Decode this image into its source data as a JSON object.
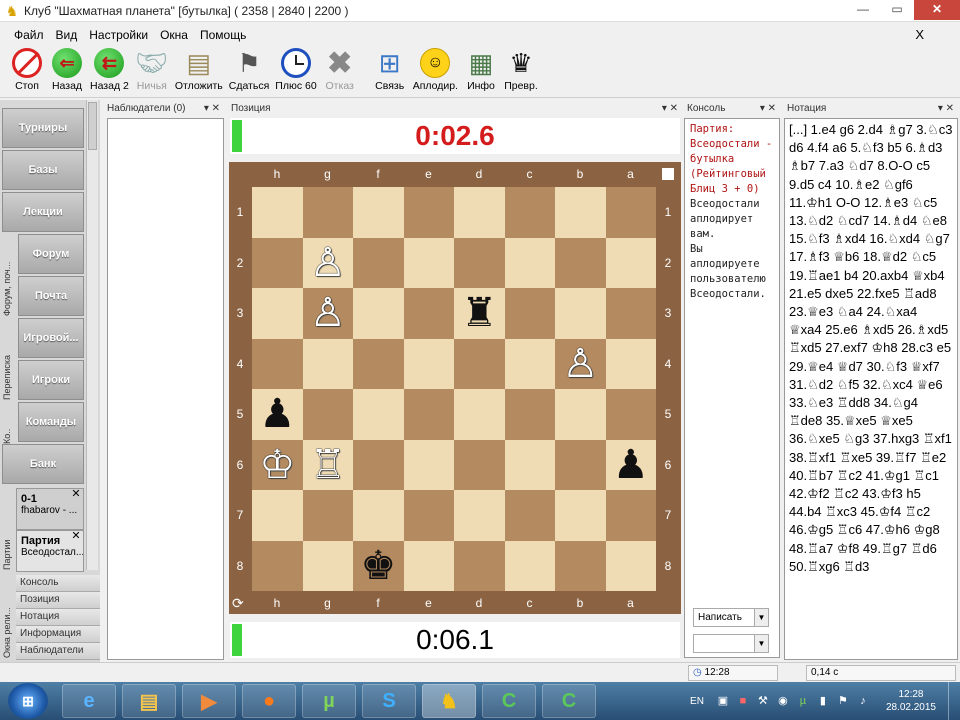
{
  "window": {
    "title": "Клуб \"Шахматная планета\" [бутылка]  ( 2358 | 2840 | 2200 )",
    "minimize": "—",
    "maximize": "▭",
    "close": "✕"
  },
  "menu": {
    "items": [
      "Файл",
      "Вид",
      "Настройки",
      "Окна",
      "Помощь"
    ],
    "close_x": "X"
  },
  "toolbar": {
    "buttons": [
      {
        "label": "Стоп",
        "icon": "stop-icon"
      },
      {
        "label": "Назад",
        "icon": "back-arrow-icon"
      },
      {
        "label": "Назад 2",
        "icon": "back-double-arrow-icon"
      },
      {
        "label": "Ничья",
        "icon": "handshake-icon",
        "disabled": true
      },
      {
        "label": "Отложить",
        "icon": "postpone-icon"
      },
      {
        "label": "Сдаться",
        "icon": "white-flag-icon"
      },
      {
        "label": "Плюс 60",
        "icon": "clock-icon"
      },
      {
        "label": "Отказ",
        "icon": "refuse-x-icon",
        "disabled": true
      },
      {
        "label": "Связь",
        "icon": "network-icon"
      },
      {
        "label": "Аплодир.",
        "icon": "smiley-icon"
      },
      {
        "label": "Инфо",
        "icon": "info-card-icon"
      },
      {
        "label": "Превр.",
        "icon": "queen-promotion-icon"
      }
    ]
  },
  "leftnav": {
    "buttons": [
      "Турниры",
      "Базы",
      "Лекции",
      "Форум",
      "Почта",
      "Игровой...",
      "Игроки",
      "Команды",
      "Банк"
    ],
    "vertical_labels": [
      "Форум, поч...",
      "Перепиcка",
      "Ко..",
      "Партии",
      "Окна рели..."
    ],
    "game_tabs": [
      {
        "title": "0-1",
        "subtitle": "fhabarov - ..."
      },
      {
        "title": "Партия",
        "subtitle": "Всеодостал..."
      }
    ],
    "bottom_items": [
      "Консоль",
      "Позиция",
      "Нотация",
      "Информация",
      "Наблюдатели"
    ]
  },
  "panels": {
    "observers": "Наблюдатели (0)",
    "position": "Позиция",
    "console": "Консоль",
    "notation": "Нотация",
    "panel_controls": "▾ ✕"
  },
  "clocks": {
    "top": "0:02.6",
    "bottom": "0:06.1",
    "top_color": "#d41c1c",
    "bottom_color": "#111111",
    "active_color": "#3ed43e"
  },
  "board": {
    "files": [
      "h",
      "g",
      "f",
      "e",
      "d",
      "c",
      "b",
      "a"
    ],
    "ranks": [
      "1",
      "2",
      "3",
      "4",
      "5",
      "6",
      "7",
      "8"
    ],
    "light_color": "#f0dcb4",
    "dark_color": "#b48b60",
    "frame_color": "#8b6343",
    "pieces": [
      {
        "square": "g2",
        "glyph": "♙",
        "color": "white"
      },
      {
        "square": "g3",
        "glyph": "♙",
        "color": "white"
      },
      {
        "square": "d3",
        "glyph": "♜",
        "color": "black"
      },
      {
        "square": "b4",
        "glyph": "♙",
        "color": "white"
      },
      {
        "square": "h5",
        "glyph": "♟",
        "color": "black"
      },
      {
        "square": "h6",
        "glyph": "♔",
        "color": "white"
      },
      {
        "square": "g6",
        "glyph": "♖",
        "color": "white"
      },
      {
        "square": "a6",
        "glyph": "♟",
        "color": "black"
      },
      {
        "square": "f8",
        "glyph": "♚",
        "color": "black"
      }
    ]
  },
  "console": {
    "game_header": "Партия: Всеодостали - бутылка (Рейтинговый Блиц 3 + 0)",
    "message1": "Всеодостали аплодирует вам.",
    "message2": "Вы аплодируете пользователю Всеодостали.",
    "write_select": "Написать",
    "second_select": ""
  },
  "notation": "[...] 1.e4 g6 2.d4 ♗g7 3.♘c3 d6 4.f4 a6 5.♘f3 b5 6.♗d3 ♗b7 7.a3 ♘d7 8.O-O c5 9.d5 c4 10.♗e2 ♘gf6 11.♔h1 O-O 12.♗e3 ♘c5 13.♘d2 ♘cd7 14.♗d4 ♘e8 15.♘f3 ♗xd4 16.♘xd4 ♘g7 17.♗f3 ♕b6 18.♕d2 ♘c5 19.♖ae1 b4 20.axb4 ♕xb4 21.e5 dxe5 22.fxe5 ♖ad8 23.♕e3 ♘a4 24.♘xa4 ♕xa4 25.e6 ♗xd5 26.♗xd5 ♖xd5 27.exf7 ♔h8 28.c3 e5 29.♕e4 ♕d7 30.♘f3 ♕xf7 31.♘d2 ♘f5 32.♘xc4 ♕e6 33.♘e3 ♖dd8 34.♘g4 ♖de8 35.♕xe5 ♕xe5 36.♘xe5 ♘g3 37.hxg3 ♖xf1 38.♖xf1 ♖xe5 39.♖f7 ♖e2 40.♖b7 ♖c2 41.♔g1 ♖c1 42.♔f2 ♖c2 43.♔f3 h5 44.b4 ♖xc3 45.♔f4 ♖c2 46.♔g5 ♖c6 47.♔h6 ♔g8 48.♖a7 ♔f8 49.♖g7 ♖d6 50.♖xg6 ♖d3",
  "statusbar": {
    "time": "12:28",
    "lag": "0,14 с"
  },
  "taskbar": {
    "start": "⊞",
    "apps": [
      {
        "name": "ie-icon",
        "glyph": "e"
      },
      {
        "name": "explorer-icon",
        "glyph": "▤"
      },
      {
        "name": "media-player-icon",
        "glyph": "▶"
      },
      {
        "name": "firefox-icon",
        "glyph": "●"
      },
      {
        "name": "utorrent-icon",
        "glyph": "µ"
      },
      {
        "name": "skype-icon",
        "glyph": "S"
      },
      {
        "name": "chess-planet-icon",
        "glyph": "♞"
      },
      {
        "name": "camtasia-icon-1",
        "glyph": "C"
      },
      {
        "name": "camtasia-icon-2",
        "glyph": "C"
      }
    ],
    "lang": "EN",
    "time": "12:28",
    "date": "28.02.2015"
  }
}
